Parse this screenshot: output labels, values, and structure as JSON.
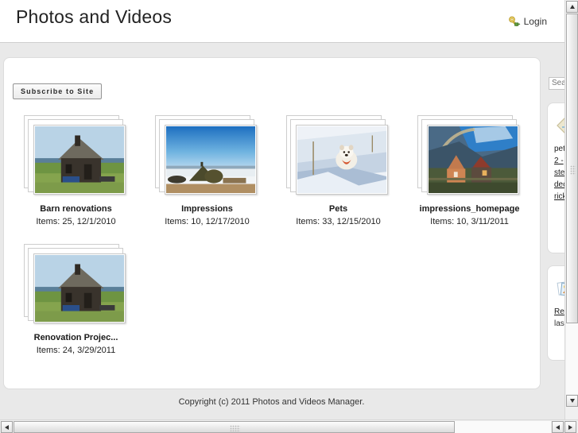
{
  "header": {
    "site_title": "Photos and Videos",
    "login_label": "Login",
    "login_icon": "key-login-icon"
  },
  "toolbar": {
    "subscribe_label": "Subscribe to Site"
  },
  "albums": [
    {
      "title": "Barn renovations",
      "meta": "Items: 25, 12/1/2010",
      "image": "old-wooden-house-green-field"
    },
    {
      "title": "Impressions",
      "meta": "Items: 10, 12/17/2010",
      "image": "blue-sky-snow-landscape-rock"
    },
    {
      "title": "Pets",
      "meta": "Items: 33, 12/15/2010",
      "image": "white-dog-in-snow"
    },
    {
      "title": "impressions_homepage",
      "meta": "Items: 10, 3/11/2011",
      "image": "rainbow-over-farm-buildings"
    },
    {
      "title": "Renovation Projec...",
      "meta": "Items: 24, 3/29/2011",
      "image": "old-wooden-house-green-field"
    }
  ],
  "sidebar": {
    "search": {
      "value": "",
      "placeholder": "Search"
    },
    "tags_panel": {
      "icon": "tag-diamond-icon",
      "links": [
        "pet",
        "2 -",
        "ste",
        "dec",
        "rick"
      ]
    },
    "recent_panel": {
      "icon": "photo-stack-icon",
      "link": "Re",
      "subtitle": "las"
    }
  },
  "footer": {
    "copyright": "Copyright (c) 2011 Photos and Videos Manager."
  },
  "scrollbars": {
    "vertical_up": "scroll-up-arrow",
    "vertical_down": "scroll-down-arrow",
    "horizontal_left": "scroll-left-arrow",
    "horizontal_right": "scroll-right-arrow"
  }
}
